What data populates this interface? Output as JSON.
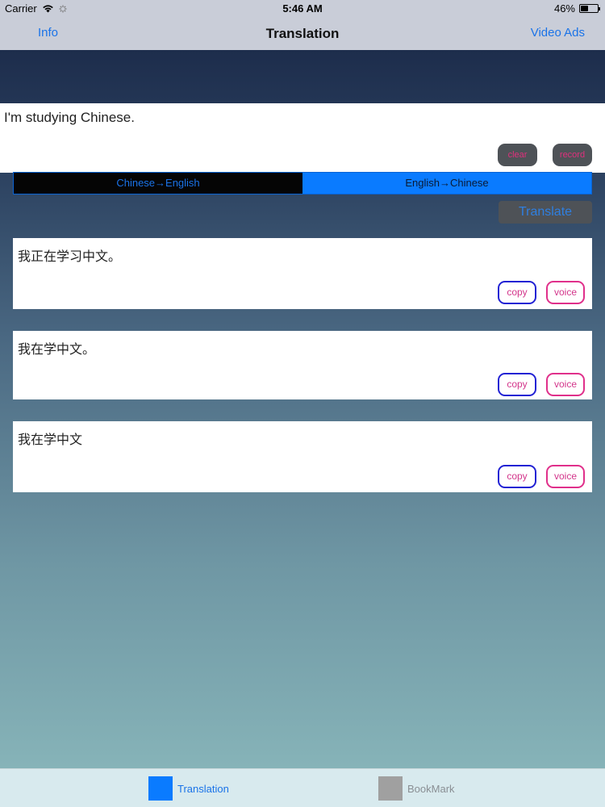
{
  "status_bar": {
    "carrier": "Carrier",
    "time": "5:46 AM",
    "battery": "46%",
    "battery_level": 0.46
  },
  "nav": {
    "left": "Info",
    "title": "Translation",
    "right": "Video Ads"
  },
  "input": {
    "value": "I'm studying Chinese."
  },
  "input_buttons": {
    "left_label": "clear",
    "right_label": "record"
  },
  "segment": {
    "option_1": "Chinese→English",
    "option_2": "English→Chinese",
    "selected": "English→Chinese"
  },
  "translate": {
    "label": "Translate"
  },
  "results": [
    {
      "text": "我正在学习中文。",
      "copy_label": "copy",
      "voice_label": "voice"
    },
    {
      "text": "我在学中文。",
      "copy_label": "copy",
      "voice_label": "voice"
    },
    {
      "text": "我在学中文",
      "copy_label": "copy",
      "voice_label": "voice"
    }
  ],
  "tabs": [
    {
      "label": "Translation",
      "active": true,
      "color": "#0a7bff"
    },
    {
      "label": "BookMark",
      "active": false,
      "color": "#a0a0a0"
    }
  ]
}
